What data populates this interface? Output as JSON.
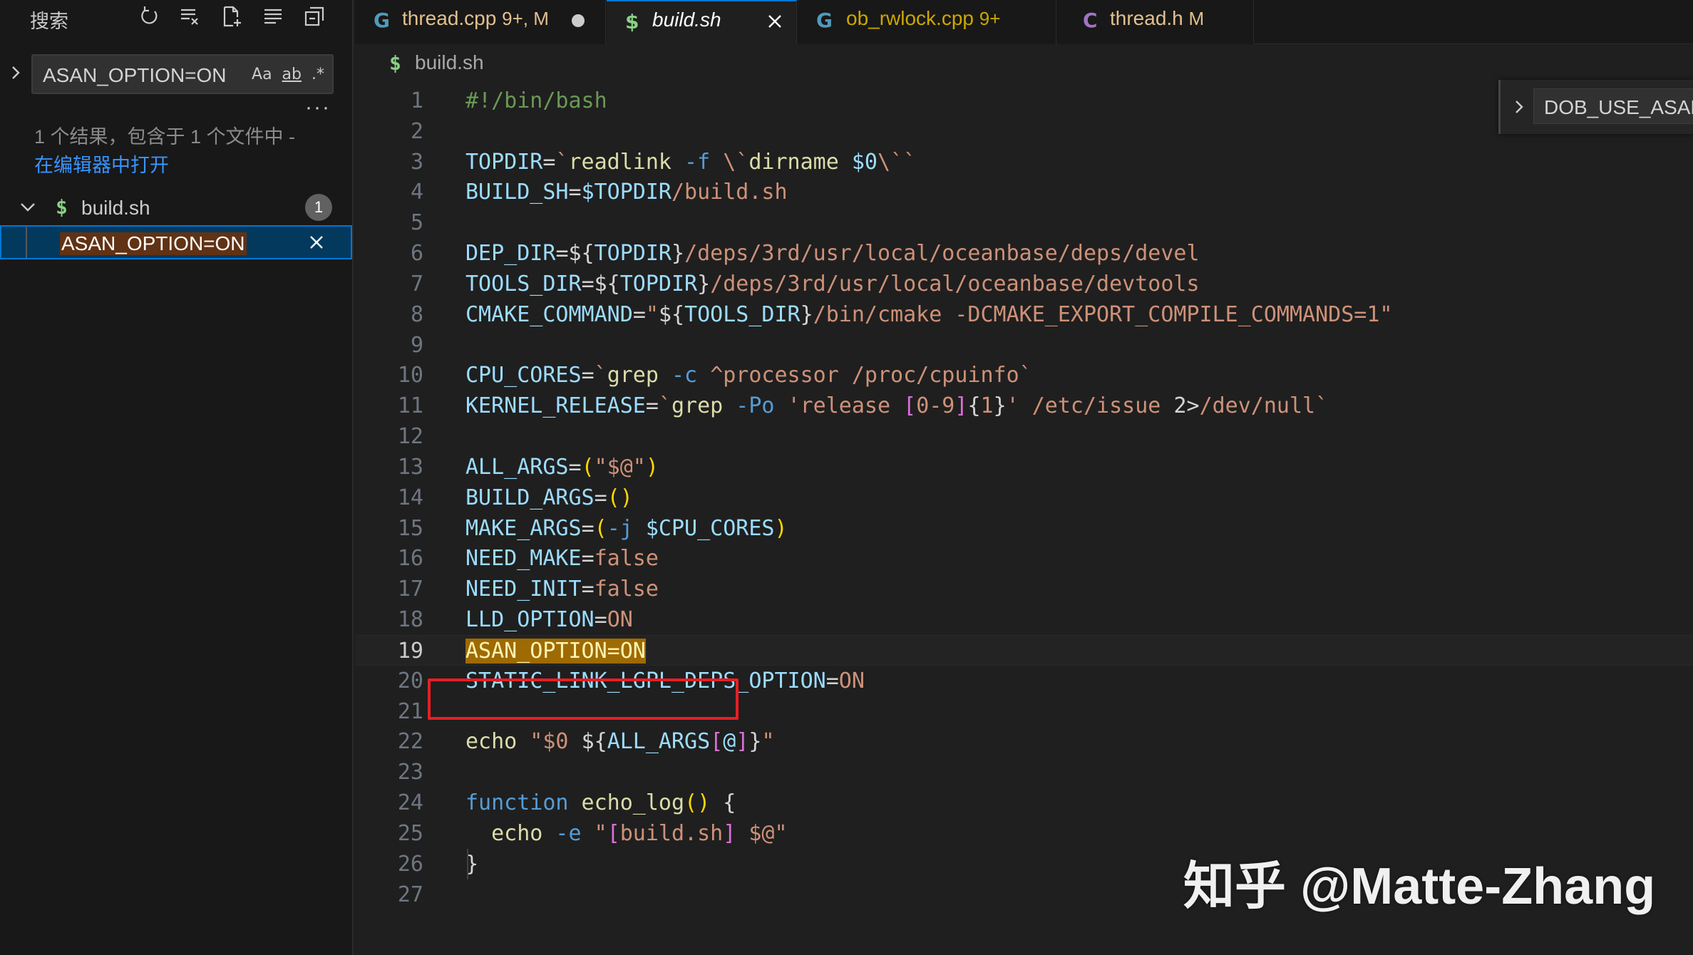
{
  "sidebar": {
    "title": "搜索",
    "search": {
      "value": "ASAN_OPTION=ON",
      "match_case": "Aa",
      "match_word": "ab",
      "regex": ".*"
    },
    "more": "···",
    "summary": "1 个结果，包含于 1 个文件中 -",
    "open_in_editor": "在编辑器中打开",
    "file": {
      "icon": "$",
      "name": "build.sh",
      "count": "1"
    },
    "match": {
      "text": "ASAN_OPTION=ON"
    }
  },
  "tabs": [
    {
      "icon": "G",
      "name": "thread.cpp",
      "badge": "9+, M",
      "color": "#e2c08d",
      "icon_color": "#519aba"
    },
    {
      "icon": "$",
      "name": "build.sh",
      "badge": "",
      "color": "#ffffff",
      "icon_color": "#89d185"
    },
    {
      "icon": "G",
      "name": "ob_rwlock.cpp",
      "badge": "9+",
      "color": "#cca700",
      "icon_color": "#519aba"
    },
    {
      "icon": "C",
      "name": "thread.h",
      "badge": "M",
      "color": "#e2c08d",
      "icon_color": "#a074c4"
    }
  ],
  "breadcrumb": {
    "icon": "$",
    "file": "build.sh"
  },
  "find_widget": {
    "value": "DOB_USE_ASAN"
  },
  "editor": {
    "current_line": 19,
    "lines": [
      [
        [
          "c-comment",
          "#!/bin/bash"
        ]
      ],
      [],
      [
        [
          "c-var",
          "TOPDIR"
        ],
        [
          "c-op",
          "="
        ],
        [
          "c-str",
          "`"
        ],
        [
          "c-fn",
          "readlink"
        ],
        [
          "c-kw",
          " -f "
        ],
        [
          "c-str",
          "\\`"
        ],
        [
          "c-fn",
          "dirname"
        ],
        [
          "c-var",
          " $0"
        ],
        [
          "c-str",
          "\\``"
        ]
      ],
      [
        [
          "c-var",
          "BUILD_SH"
        ],
        [
          "c-op",
          "="
        ],
        [
          "c-var",
          "$TOPDIR"
        ],
        [
          "c-str",
          "/build.sh"
        ]
      ],
      [],
      [
        [
          "c-var",
          "DEP_DIR"
        ],
        [
          "c-op",
          "="
        ],
        [
          "c-plain",
          "${"
        ],
        [
          "c-var",
          "TOPDIR"
        ],
        [
          "c-plain",
          "}"
        ],
        [
          "c-str",
          "/deps/3rd/usr/local/oceanbase/deps/devel"
        ]
      ],
      [
        [
          "c-var",
          "TOOLS_DIR"
        ],
        [
          "c-op",
          "="
        ],
        [
          "c-plain",
          "${"
        ],
        [
          "c-var",
          "TOPDIR"
        ],
        [
          "c-plain",
          "}"
        ],
        [
          "c-str",
          "/deps/3rd/usr/local/oceanbase/devtools"
        ]
      ],
      [
        [
          "c-var",
          "CMAKE_COMMAND"
        ],
        [
          "c-op",
          "="
        ],
        [
          "c-str",
          "\""
        ],
        [
          "c-plain",
          "${"
        ],
        [
          "c-var",
          "TOOLS_DIR"
        ],
        [
          "c-plain",
          "}"
        ],
        [
          "c-str",
          "/bin/cmake -DCMAKE_EXPORT_COMPILE_COMMANDS=1\""
        ]
      ],
      [],
      [
        [
          "c-var",
          "CPU_CORES"
        ],
        [
          "c-op",
          "="
        ],
        [
          "c-str",
          "`"
        ],
        [
          "c-fn",
          "grep"
        ],
        [
          "c-kw",
          " -c "
        ],
        [
          "c-str",
          "^processor /proc/cpuinfo`"
        ]
      ],
      [
        [
          "c-var",
          "KERNEL_RELEASE"
        ],
        [
          "c-op",
          "="
        ],
        [
          "c-str",
          "`"
        ],
        [
          "c-fn",
          "grep"
        ],
        [
          "c-kw",
          " -Po "
        ],
        [
          "c-str",
          "'release "
        ],
        [
          "c-bracket2",
          "["
        ],
        [
          "c-str",
          "0-9"
        ],
        [
          "c-bracket2",
          "]"
        ],
        [
          "c-plain",
          "{"
        ],
        [
          "c-str",
          "1"
        ],
        [
          "c-plain",
          "}"
        ],
        [
          "c-str",
          "' /etc/issue "
        ],
        [
          "c-plain",
          "2>"
        ],
        [
          "c-str",
          "/dev/null`"
        ]
      ],
      [],
      [
        [
          "c-var",
          "ALL_ARGS"
        ],
        [
          "c-op",
          "="
        ],
        [
          "c-bracket",
          "("
        ],
        [
          "c-str",
          "\"$@\""
        ],
        [
          "c-bracket",
          ")"
        ]
      ],
      [
        [
          "c-var",
          "BUILD_ARGS"
        ],
        [
          "c-op",
          "="
        ],
        [
          "c-bracket",
          "()"
        ]
      ],
      [
        [
          "c-var",
          "MAKE_ARGS"
        ],
        [
          "c-op",
          "="
        ],
        [
          "c-bracket",
          "("
        ],
        [
          "c-kw",
          "-j "
        ],
        [
          "c-var",
          "$CPU_CORES"
        ],
        [
          "c-bracket",
          ")"
        ]
      ],
      [
        [
          "c-var",
          "NEED_MAKE"
        ],
        [
          "c-op",
          "="
        ],
        [
          "c-str",
          "false"
        ]
      ],
      [
        [
          "c-var",
          "NEED_INIT"
        ],
        [
          "c-op",
          "="
        ],
        [
          "c-str",
          "false"
        ]
      ],
      [
        [
          "c-var",
          "LLD_OPTION"
        ],
        [
          "c-op",
          "="
        ],
        [
          "c-str",
          "ON"
        ]
      ],
      [
        [
          "match-hl",
          "ASAN_OPTION=ON"
        ]
      ],
      [
        [
          "c-var",
          "STATIC_LINK_LGPL_DEPS_OPTION"
        ],
        [
          "c-op",
          "="
        ],
        [
          "c-str",
          "ON"
        ]
      ],
      [],
      [
        [
          "c-fn",
          "echo"
        ],
        [
          "c-str",
          " \"$0 "
        ],
        [
          "c-plain",
          "${"
        ],
        [
          "c-var",
          "ALL_ARGS"
        ],
        [
          "c-bracket2",
          "["
        ],
        [
          "c-var",
          "@"
        ],
        [
          "c-bracket2",
          "]"
        ],
        [
          "c-plain",
          "}"
        ],
        [
          "c-str",
          "\""
        ]
      ],
      [],
      [
        [
          "c-kw",
          "function"
        ],
        [
          "c-fn",
          " echo_log"
        ],
        [
          "c-bracket",
          "()"
        ],
        [
          "c-plain",
          " {"
        ]
      ],
      [
        [
          "c-plain",
          "  "
        ],
        [
          "c-fn",
          "echo"
        ],
        [
          "c-kw",
          " -e "
        ],
        [
          "c-str",
          "\""
        ],
        [
          "c-bracket2",
          "["
        ],
        [
          "c-str",
          "build.sh"
        ],
        [
          "c-bracket2",
          "]"
        ],
        [
          "c-str",
          " $@\""
        ]
      ],
      [
        [
          "c-plain",
          "}"
        ]
      ],
      []
    ]
  },
  "watermark": "知乎 @Matte-Zhang"
}
